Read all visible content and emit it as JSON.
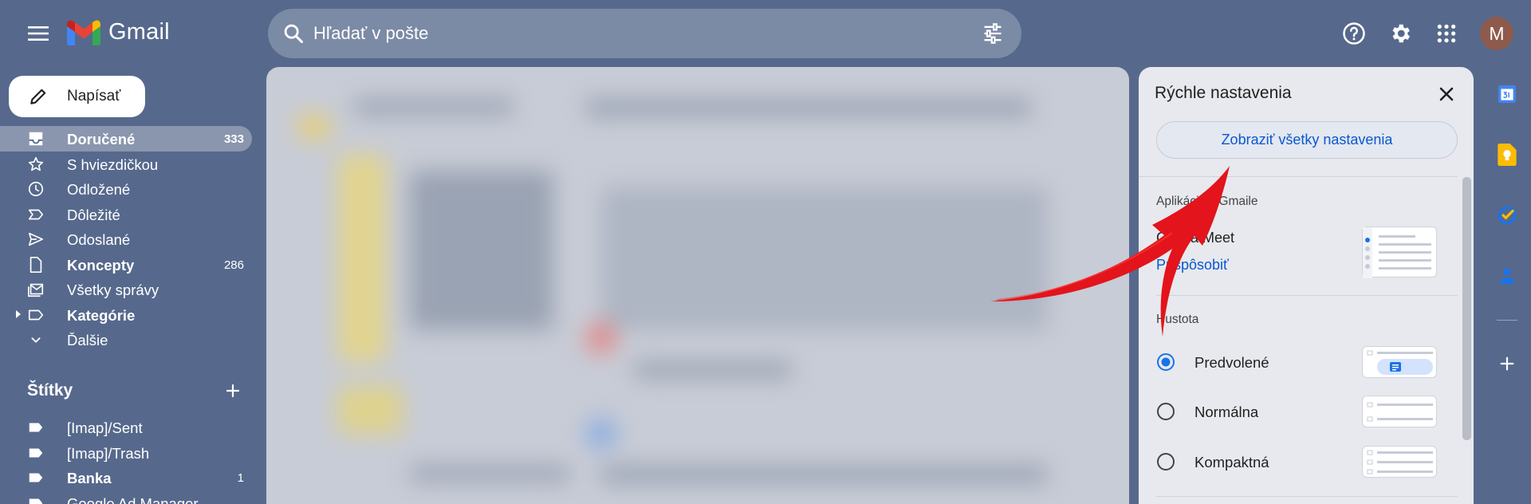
{
  "app": {
    "name": "Gmail",
    "avatar_letter": "M"
  },
  "search": {
    "placeholder": "Hľadať v pošte"
  },
  "compose": {
    "label": "Napísať"
  },
  "nav": [
    {
      "label": "Doručené",
      "count": "333",
      "bold": true,
      "active": true,
      "icon": "inbox-icon"
    },
    {
      "label": "S hviezdičkou",
      "count": "",
      "bold": false,
      "icon": "star-icon"
    },
    {
      "label": "Odložené",
      "count": "",
      "bold": false,
      "icon": "clock-icon"
    },
    {
      "label": "Dôležité",
      "count": "",
      "bold": false,
      "icon": "important-icon"
    },
    {
      "label": "Odoslané",
      "count": "",
      "bold": false,
      "icon": "send-icon"
    },
    {
      "label": "Koncepty",
      "count": "286",
      "bold": true,
      "icon": "draft-icon"
    },
    {
      "label": "Všetky správy",
      "count": "",
      "bold": false,
      "icon": "all-mail-icon"
    },
    {
      "label": "Kategórie",
      "count": "",
      "bold": true,
      "icon": "label-outline-icon"
    },
    {
      "label": "Ďalšie",
      "count": "",
      "bold": false,
      "icon": "chevron-down-icon"
    }
  ],
  "labels": {
    "heading": "Štítky",
    "items": [
      {
        "label": "[Imap]/Sent",
        "count": "",
        "bold": false
      },
      {
        "label": "[Imap]/Trash",
        "count": "",
        "bold": false
      },
      {
        "label": "Banka",
        "count": "1",
        "bold": true
      },
      {
        "label": "Google Ad Manager",
        "count": "",
        "bold": false
      }
    ]
  },
  "quick_settings": {
    "title": "Rýchle nastavenia",
    "see_all": "Zobraziť všetky nastavenia",
    "apps_section": "Aplikácie v Gmaile",
    "apps_value": "Chat a Meet",
    "customize": "Prispôsobiť",
    "density_section": "Hustota",
    "density_options": [
      {
        "label": "Predvolené",
        "selected": true
      },
      {
        "label": "Normálna",
        "selected": false
      },
      {
        "label": "Kompaktná",
        "selected": false
      }
    ]
  },
  "colors": {
    "background": "#56698c",
    "accent": "#0b57d0",
    "arrow": "#e3141b"
  }
}
